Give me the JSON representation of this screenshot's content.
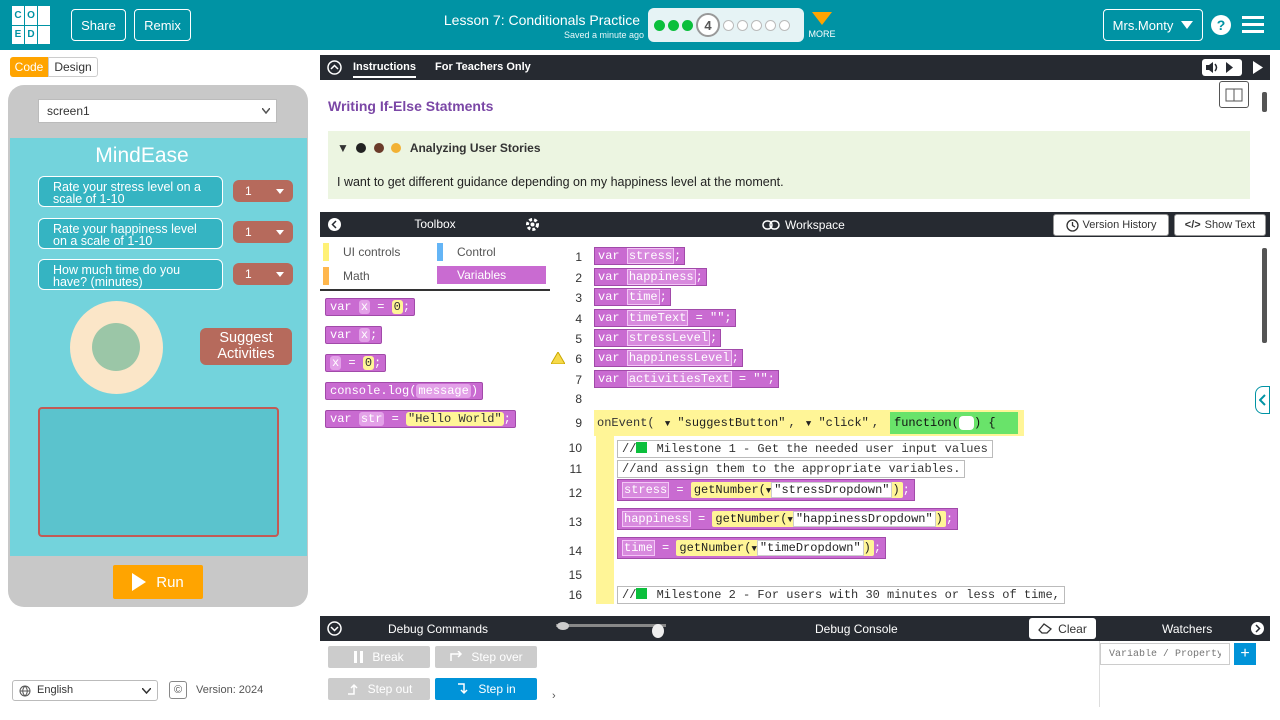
{
  "header": {
    "logo_letters": [
      "C",
      "O",
      "D",
      "E"
    ],
    "share_label": "Share",
    "remix_label": "Remix",
    "lesson_title": "Lesson 7: Conditionals Practice",
    "saved_text": "Saved a minute ago",
    "current_level": "4",
    "more_label": "MORE",
    "user_name": "Mrs.Monty",
    "accent": "#0093a4"
  },
  "left": {
    "code_tab": "Code",
    "design_tab": "Design",
    "screen_select": "screen1",
    "app_title": "MindEase",
    "questions": [
      {
        "label": "Rate your stress level on a scale of 1-10",
        "value": "1"
      },
      {
        "label": "Rate your happiness level on a scale of 1-10",
        "value": "1"
      },
      {
        "label": "How much time do you have? (minutes)",
        "value": "1"
      }
    ],
    "suggest_label": "Suggest Activities",
    "run_label": "Run",
    "language": "English",
    "version": "Version: 2024"
  },
  "instructions": {
    "tab_instructions": "Instructions",
    "tab_teachers": "For Teachers Only",
    "title": "Writing If-Else Statments",
    "story_heading": "Analyzing User Stories",
    "story_text": "I want to get different guidance depending on my happiness level at the moment."
  },
  "toolbox": {
    "title": "Toolbox",
    "categories": [
      {
        "label": "UI controls",
        "color": "#fff176"
      },
      {
        "label": "Control",
        "color": "#64b5f6"
      },
      {
        "label": "Math",
        "color": "#ffb74d"
      },
      {
        "label": "Variables",
        "color": "#c96bd1"
      }
    ],
    "blocks": [
      {
        "pre": "var ",
        "v": "x",
        "post": " = ",
        "y": "0",
        "end": ";"
      },
      {
        "pre": "var ",
        "v": "x",
        "post": ";",
        "y": "",
        "end": ""
      },
      {
        "pre": "",
        "v": "x",
        "post": " = ",
        "y": "0",
        "end": ";"
      },
      {
        "pre": "console.log(",
        "v": "message",
        "post": ")",
        "y": "",
        "end": ""
      },
      {
        "pre": "var ",
        "v": "str",
        "post": " = ",
        "y": "\"Hello World\"",
        "end": ";"
      }
    ]
  },
  "workspace": {
    "title": "Workspace",
    "version_history": "Version History",
    "show_text": "Show Text",
    "lines": [
      {
        "n": "1",
        "name": "stress",
        "tail": ";"
      },
      {
        "n": "2",
        "name": "happiness",
        "tail": ";"
      },
      {
        "n": "3",
        "name": "time",
        "tail": ";"
      },
      {
        "n": "4",
        "name": "timeText",
        "tail": " = \"\";"
      },
      {
        "n": "5",
        "name": "stressLevel",
        "tail": ";"
      },
      {
        "n": "6",
        "name": "happinessLevel",
        "tail": ";"
      },
      {
        "n": "7",
        "name": "activitiesText",
        "tail": " = \"\";"
      }
    ],
    "line_numbers_extra": [
      "8",
      "9",
      "10",
      "11",
      "12",
      "13",
      "14",
      "15",
      "16"
    ],
    "event_text": "onEvent(",
    "event_id": "\"suggestButton\"",
    "event_type": "\"click\"",
    "function_text": "function(",
    "comment1": "Milestone 1 - Get the needed user input values",
    "comment2": "//and assign them to the appropriate variables.",
    "assign": [
      {
        "var": "stress",
        "fn": "getNumber(",
        "arg": "\"stressDropdown\""
      },
      {
        "var": "happiness",
        "fn": "getNumber(",
        "arg": "\"happinessDropdown\""
      },
      {
        "var": "time",
        "fn": "getNumber(",
        "arg": "\"timeDropdown\""
      }
    ],
    "comment3": "Milestone 2 - For users with 30 minutes or less of time,"
  },
  "debug": {
    "commands": "Debug Commands",
    "console": "Debug Console",
    "clear": "Clear",
    "watchers": "Watchers",
    "break": "Break",
    "step_over": "Step over",
    "step_out": "Step out",
    "step_in": "Step in",
    "watch_placeholder": "Variable / Property"
  }
}
